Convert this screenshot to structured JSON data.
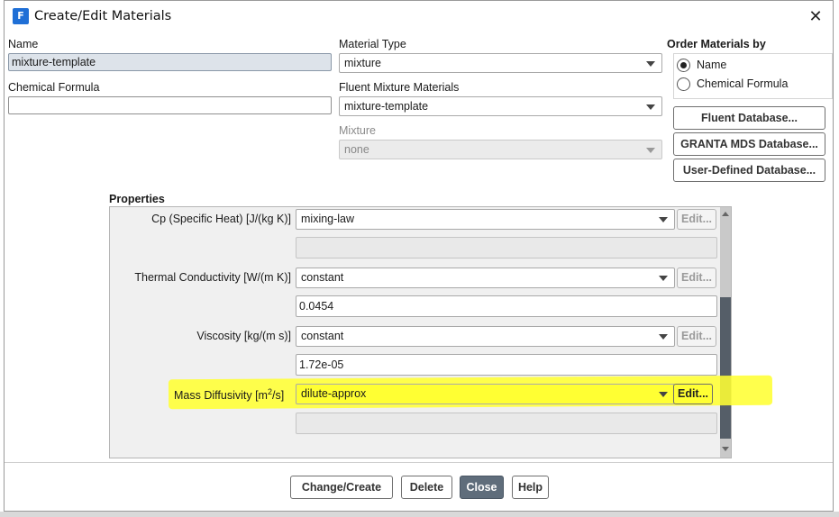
{
  "window": {
    "title": "Create/Edit Materials",
    "icon_letter": "F"
  },
  "name": {
    "label": "Name",
    "value": "mixture-template"
  },
  "chemical_formula": {
    "label": "Chemical Formula",
    "value": ""
  },
  "material_type": {
    "label": "Material Type",
    "value": "mixture"
  },
  "fluent_mixture_materials": {
    "label": "Fluent Mixture Materials",
    "value": "mixture-template"
  },
  "mixture": {
    "label": "Mixture",
    "value": "none"
  },
  "order_by": {
    "label": "Order Materials by",
    "options": [
      {
        "label": "Name",
        "selected": true
      },
      {
        "label": "Chemical Formula",
        "selected": false
      }
    ]
  },
  "database_buttons": {
    "fluent": "Fluent Database...",
    "granta": "GRANTA MDS Database...",
    "user_defined": "User-Defined Database..."
  },
  "properties": {
    "heading": "Properties",
    "edit_label": "Edit...",
    "rows": [
      {
        "label": "Cp (Specific Heat) [J/(kg K)]",
        "method": "mixing-law",
        "value": ""
      },
      {
        "label": "Thermal Conductivity [W/(m K)]",
        "method": "constant",
        "value": "0.0454"
      },
      {
        "label": "Viscosity [kg/(m s)]",
        "method": "constant",
        "value": "1.72e-05"
      },
      {
        "label_main": "Mass Diffusivity [m",
        "label_sup": "2",
        "label_tail": "/s]",
        "method": "dilute-approx",
        "value": ""
      }
    ]
  },
  "footer": {
    "change_create": "Change/Create",
    "delete": "Delete",
    "close": "Close",
    "help": "Help"
  },
  "colors": {
    "highlight": "#ffff33",
    "primary_button": "#5f6d7b",
    "scroll_thumb": "#555e68"
  }
}
